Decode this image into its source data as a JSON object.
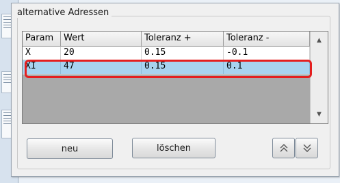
{
  "group": {
    "title": "alternative Adressen"
  },
  "table": {
    "columns": [
      "Param",
      "Wert",
      "Toleranz +",
      "Toleranz -"
    ],
    "rows": [
      [
        "X",
        "20",
        "0.15",
        "-0.1"
      ],
      [
        "XI",
        "47",
        "0.15",
        "0.1"
      ]
    ],
    "selected_row": 1
  },
  "buttons": {
    "new_label": "neu",
    "delete_label": "löschen"
  },
  "icons": {
    "move_up": "double-chevron-up-icon",
    "move_down": "double-chevron-down-icon",
    "scroll_up": "scroll-up-arrow-icon",
    "scroll_down": "scroll-down-arrow-icon"
  },
  "colors": {
    "selection": "#a8d3ef",
    "highlight_border": "#e41f1f"
  }
}
